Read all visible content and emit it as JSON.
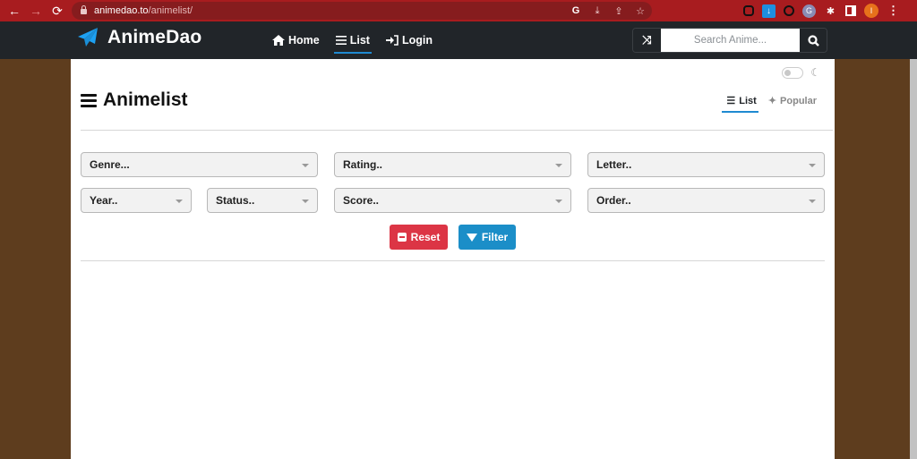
{
  "browser": {
    "url_host": "animedao.to",
    "url_path": "/animelist/",
    "back_icon": "←",
    "forward_icon": "→",
    "reload_icon": "⟳",
    "profile_initial": "I"
  },
  "header": {
    "brand": "AnimeDao",
    "nav": [
      {
        "label": "Home",
        "icon": "home-icon",
        "active": false
      },
      {
        "label": "List",
        "icon": "list-icon",
        "active": true
      },
      {
        "label": "Login",
        "icon": "login-icon",
        "active": false
      }
    ],
    "search": {
      "placeholder": "Search Anime...",
      "value": ""
    }
  },
  "page": {
    "title": "Animelist",
    "view_tabs": [
      {
        "label": "List",
        "active": true
      },
      {
        "label": "Popular",
        "active": false
      }
    ],
    "dark_mode_enabled": false
  },
  "filters": {
    "genre": "Genre...",
    "rating": "Rating..",
    "letter": "Letter..",
    "year": "Year..",
    "status": "Status..",
    "score": "Score..",
    "order": "Order.."
  },
  "actions": {
    "reset_label": "Reset",
    "filter_label": "Filter"
  },
  "colors": {
    "chrome_bar": "#a81c1f",
    "header_bg": "#212529",
    "accent": "#1f8ad1",
    "reset": "#dc3545",
    "filter": "#1b8ec8",
    "background_wood": "#5e3d1e"
  }
}
